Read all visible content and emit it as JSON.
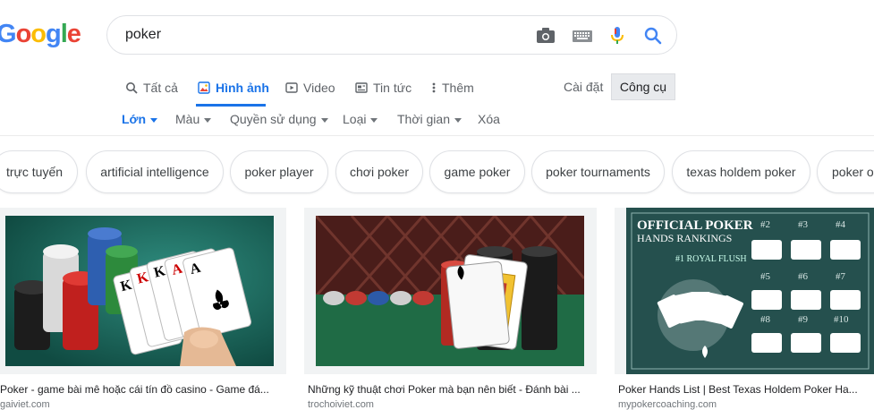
{
  "logo": {
    "letters": [
      "G",
      "o",
      "o",
      "g",
      "l",
      "e"
    ],
    "colors": [
      "#4285f4",
      "#ea4335",
      "#fbbc05",
      "#4285f4",
      "#34a853",
      "#ea4335"
    ]
  },
  "search": {
    "value": "poker",
    "icons": [
      "camera-icon",
      "keyboard-icon",
      "mic-icon",
      "search-icon"
    ]
  },
  "tabs": [
    {
      "label": "Tất cả",
      "icon": "search-icon"
    },
    {
      "label": "Hình ảnh",
      "icon": "image-icon"
    },
    {
      "label": "Video",
      "icon": "video-icon"
    },
    {
      "label": "Tin tức",
      "icon": "news-icon"
    },
    {
      "label": "Thêm",
      "icon": "more-icon"
    }
  ],
  "settings_label": "Cài đặt",
  "tools_label": "Công cụ",
  "filters": [
    {
      "label": "Lớn"
    },
    {
      "label": "Màu"
    },
    {
      "label": "Quyền sử dụng"
    },
    {
      "label": "Loại"
    },
    {
      "label": "Thời gian"
    },
    {
      "label": "Xóa"
    }
  ],
  "chips": [
    "trực tuyến",
    "artificial intelligence",
    "poker player",
    "chơi poker",
    "game poker",
    "poker tournaments",
    "texas holdem poker",
    "poker o"
  ],
  "results": [
    {
      "caption": "Poker - game bài mê hoặc cái tín đồ casino - Game đá...",
      "domain": "gaiviet.com"
    },
    {
      "caption": "Những kỹ thuật chơi Poker mà bạn nên biết - Đánh bài ...",
      "domain": "trochoiviet.com"
    },
    {
      "caption": "Poker Hands List | Best Texas Holdem Poker Ha...",
      "domain": "mypokercoaching.com"
    }
  ],
  "poster": {
    "title_line1": "OFFICIAL POKER",
    "title_line2": "HANDS RANKINGS",
    "hands": [
      "#1 ROYAL FLUSH",
      "#2",
      "#3",
      "#4",
      "#5",
      "#6",
      "#7",
      "#8",
      "#9",
      "#10"
    ],
    "card_ranks": [
      "K",
      "K",
      "K",
      "A",
      "A"
    ]
  },
  "colors": {
    "accent": "#1a73e8"
  }
}
